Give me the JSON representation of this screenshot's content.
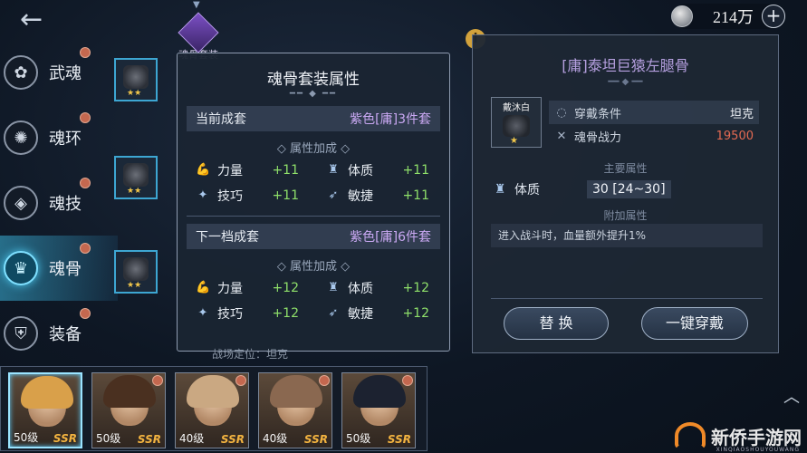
{
  "top": {
    "back_icon": "back-arrow-icon",
    "currency_amount": "214万",
    "plus": "+",
    "set_tab_label": "魂骨套装"
  },
  "sidebar": [
    {
      "label": "武魂",
      "icon": "martial-soul-icon",
      "glyph": "✿",
      "active": false,
      "dot": true
    },
    {
      "label": "魂环",
      "icon": "soul-ring-icon",
      "glyph": "✺",
      "active": false,
      "dot": true
    },
    {
      "label": "魂技",
      "icon": "soul-skill-icon",
      "glyph": "◈",
      "active": false,
      "dot": true
    },
    {
      "label": "魂骨",
      "icon": "soul-bone-icon",
      "glyph": "♛",
      "active": true,
      "dot": true
    },
    {
      "label": "装备",
      "icon": "equipment-icon",
      "glyph": "⛨",
      "active": false,
      "dot": true
    }
  ],
  "popup": {
    "title": "魂骨套装属性",
    "current_label": "当前成套",
    "current_value": "紫色[庸]3件套",
    "attr_heading": "属性加成",
    "current_attrs": [
      {
        "name": "力量",
        "bonus": "+11",
        "icon": "strength-icon",
        "glyph": "💪"
      },
      {
        "name": "体质",
        "bonus": "+11",
        "icon": "constitution-icon",
        "glyph": "♜"
      },
      {
        "name": "技巧",
        "bonus": "+11",
        "icon": "skill-icon",
        "glyph": "✦"
      },
      {
        "name": "敏捷",
        "bonus": "+11",
        "icon": "agility-icon",
        "glyph": "➶"
      }
    ],
    "next_label": "下一档成套",
    "next_value": "紫色[庸]6件套",
    "attr_heading2": "属性加成",
    "next_attrs": [
      {
        "name": "力量",
        "bonus": "+12",
        "icon": "strength-icon",
        "glyph": "💪"
      },
      {
        "name": "体质",
        "bonus": "+12",
        "icon": "constitution-icon",
        "glyph": "♜"
      },
      {
        "name": "技巧",
        "bonus": "+12",
        "icon": "skill-icon",
        "glyph": "✦"
      },
      {
        "name": "敏捷",
        "bonus": "+12",
        "icon": "agility-icon",
        "glyph": "➶"
      }
    ],
    "footer": "战场定位：坦克"
  },
  "detail": {
    "title": "[庸]泰坦巨猿左腿骨",
    "item_tag": "戴沐白",
    "req_label": "穿戴条件",
    "req_value": "坦克",
    "power_label": "魂骨战力",
    "power_value": "19500",
    "main_heading": "主要属性",
    "main_attr_name": "体质",
    "main_attr_value": "30 [24~30]",
    "extra_heading": "附加属性",
    "extra_text": "进入战斗时，血量额外提升1%",
    "btn_replace": "替 换",
    "btn_equip_all": "一键穿戴",
    "colors": {
      "red": "#e46a52",
      "purple": "#b6a0e0",
      "green": "#8fe06a"
    }
  },
  "characters": [
    {
      "level": "50级",
      "rarity": "SSR",
      "hair": "#d9a04a",
      "selected": true,
      "dot": false
    },
    {
      "level": "50级",
      "rarity": "SSR",
      "hair": "#4a3020",
      "selected": false,
      "dot": true
    },
    {
      "level": "40级",
      "rarity": "SSR",
      "hair": "#caa882",
      "selected": false,
      "dot": true
    },
    {
      "level": "40级",
      "rarity": "SSR",
      "hair": "#8a6850",
      "selected": false,
      "dot": true
    },
    {
      "level": "50级",
      "rarity": "SSR",
      "hair": "#1c2230",
      "selected": false,
      "dot": true
    }
  ],
  "watermark": {
    "text": "新侨手游网",
    "sub": "XINQIAOSHOUYOUWANG"
  }
}
